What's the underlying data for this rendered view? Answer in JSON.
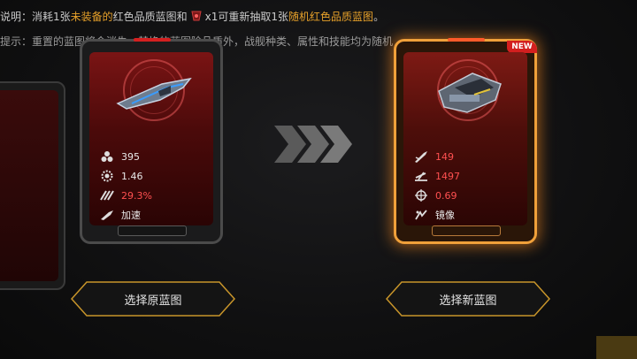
{
  "info": {
    "line1_a": "说明：消耗1张",
    "line1_b": "未装备的",
    "line1_c": "红色品质蓝图和",
    "line1_d": "x1可重新抽取1张",
    "line1_e": "随机红色品质蓝图",
    "line1_f": "。",
    "line2": "提示：重置的蓝图将会消失，替换的蓝图除品质外，战舰种类、属性和技能均为随机"
  },
  "old_card": {
    "stats": [
      {
        "icon": "triple-dot-icon",
        "value": "395"
      },
      {
        "icon": "gear-icon",
        "value": "1.46"
      },
      {
        "icon": "speed-icon",
        "value": "29.3%"
      },
      {
        "icon": "boost-icon",
        "value": "加速"
      }
    ]
  },
  "new_card": {
    "badge": "NEW",
    "stats": [
      {
        "icon": "missile-icon",
        "value": "149"
      },
      {
        "icon": "fleet-icon",
        "value": "1497"
      },
      {
        "icon": "crosshair-icon",
        "value": "0.69"
      },
      {
        "icon": "mirror-icon",
        "value": "镜像"
      }
    ]
  },
  "buttons": {
    "select_old": "选择原蓝图",
    "select_new": "选择新蓝图"
  },
  "colors": {
    "accent_orange": "#e7a12a",
    "stat_red": "#ff5050",
    "glow": "#f0a03a",
    "button_border": "#c8952a"
  }
}
